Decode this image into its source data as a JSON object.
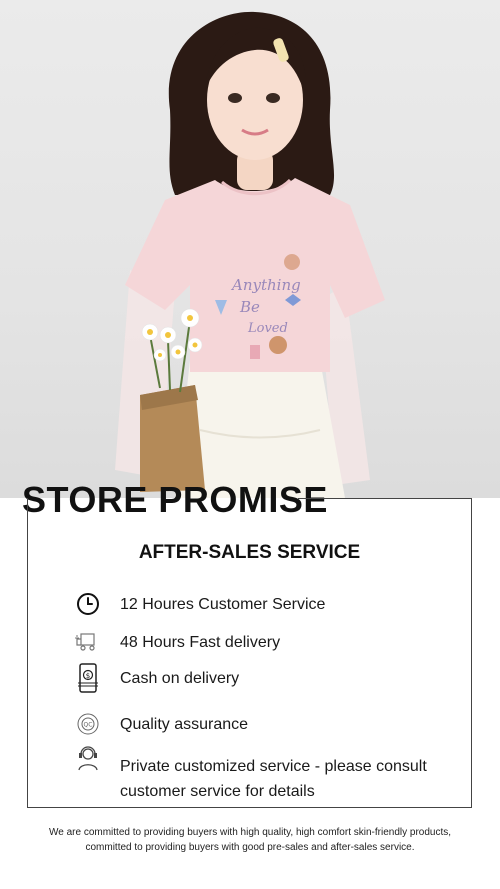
{
  "promise": {
    "title": "STORE PROMISE"
  },
  "after_sales": {
    "heading": "AFTER-SALES SERVICE",
    "items": [
      {
        "icon": "clock-icon",
        "label": "12 Houres Customer Service"
      },
      {
        "icon": "delivery-truck-icon",
        "label": "48 Hours Fast delivery"
      },
      {
        "icon": "cash-phone-icon",
        "label": "Cash on delivery"
      },
      {
        "icon": "quality-seal-icon",
        "label": "Quality assurance"
      },
      {
        "icon": "customer-service-agent-icon",
        "label": "Private customized service - please consult customer service for details"
      }
    ]
  },
  "footer": {
    "line1": "We are committed to providing buyers with high quality, high comfort skin-friendly products,",
    "line2": "committed to providing buyers with good pre-sales and after-sales service."
  },
  "colors": {
    "shirt": "#f5d6d8",
    "background": "#e6e6e6",
    "border": "#444444",
    "text": "#1a1a1a"
  }
}
